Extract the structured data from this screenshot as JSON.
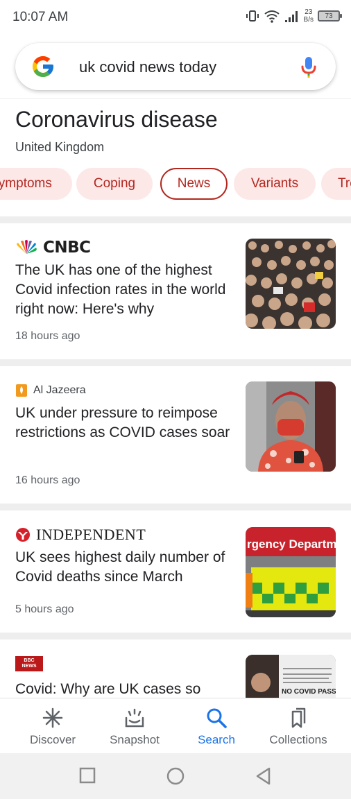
{
  "status_bar": {
    "time": "10:07 AM",
    "speed_value": "23",
    "speed_unit": "B/s",
    "battery": "73"
  },
  "search": {
    "query": "uk covid news today"
  },
  "topic": {
    "title": "Coronavirus disease",
    "subtitle": "United Kingdom",
    "chips": [
      {
        "label": "Symptoms"
      },
      {
        "label": "Coping"
      },
      {
        "label": "News",
        "selected": true
      },
      {
        "label": "Variants"
      },
      {
        "label": "Treatments"
      }
    ]
  },
  "articles": [
    {
      "source": "CNBC",
      "headline": "The UK has one of the highest Covid infection rates in the world right now: Here's why",
      "time": "18 hours ago"
    },
    {
      "source": "Al Jazeera",
      "headline": "UK under pressure to reimpose restrictions as COVID cases soar",
      "time": "16 hours ago"
    },
    {
      "source": "INDEPENDENT",
      "headline": "UK sees highest daily number of Covid deaths since March",
      "time": "5 hours ago",
      "thumb_text": "rgency Departme"
    },
    {
      "source": "BBC NEWS",
      "headline": "Covid: Why are UK cases so",
      "thumb_text": "NO COVID PASS"
    }
  ],
  "bottom_nav": [
    {
      "label": "Discover",
      "icon": "discover-icon"
    },
    {
      "label": "Snapshot",
      "icon": "snapshot-icon"
    },
    {
      "label": "Search",
      "icon": "search-icon",
      "active": true
    },
    {
      "label": "Collections",
      "icon": "collections-icon"
    }
  ],
  "colors": {
    "chip_bg": "#fde8e8",
    "chip_text": "#b3261e",
    "active_blue": "#1a73e8"
  }
}
